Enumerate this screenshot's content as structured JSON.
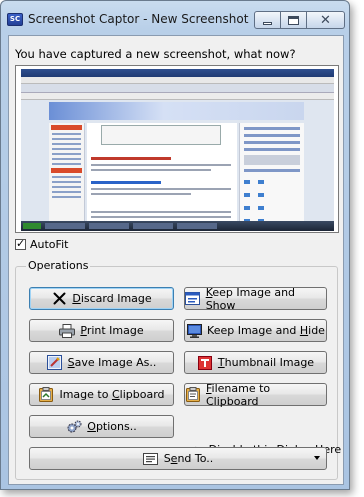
{
  "window": {
    "title": "Screenshot Captor - New Screenshot",
    "app_icon_text": "SC"
  },
  "prompt": "You have captured a new screenshot, what now?",
  "autofit": {
    "label": "AutoFit",
    "checked": true
  },
  "operations": {
    "group_label": "Operations",
    "buttons": {
      "discard": {
        "label": "Discard Image",
        "mnemonic": "D"
      },
      "keep_show": {
        "label": "Keep Image and Show",
        "mnemonic": "K"
      },
      "print": {
        "label": "Print Image",
        "mnemonic": "P"
      },
      "keep_hide": {
        "label": "Keep Image and Hide",
        "mnemonic": "H"
      },
      "save_as": {
        "label": "Save Image As..",
        "mnemonic": "S"
      },
      "thumbnail": {
        "label": "Thumbnail Image",
        "mnemonic": "T"
      },
      "image_clipboard": {
        "label": "Image to Clipboard",
        "mnemonic": "C"
      },
      "filename_clipboard": {
        "label": "Filename to Clipboard",
        "mnemonic": "F"
      },
      "options": {
        "label": "Options..",
        "mnemonic": "O"
      },
      "send_to": {
        "label": "Send To..",
        "mnemonic": "e"
      }
    },
    "disable_hint": "<-- Disable this Dialog Here"
  },
  "colors": {
    "accent": "#3c7fb1",
    "title_bar": "#b8cfe8"
  }
}
